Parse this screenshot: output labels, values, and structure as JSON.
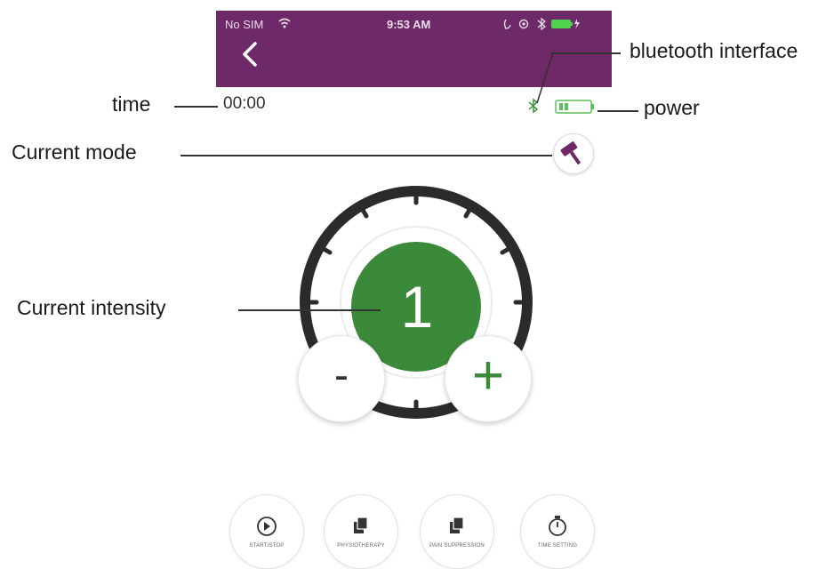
{
  "status_bar": {
    "carrier": "No SIM",
    "time": "9:53 AM",
    "background_color": "#6e2a68"
  },
  "header": {
    "back_icon": "chevron-left-icon",
    "timer": "00:00",
    "bluetooth_icon": "bluetooth-icon",
    "battery_icon": "battery-icon",
    "mode_icon": "hammer-icon"
  },
  "annotations": {
    "bluetooth": "bluetooth interface",
    "time": "time",
    "power": "power",
    "mode": "Current mode",
    "intensity": "Current intensity"
  },
  "control": {
    "intensity": "1",
    "decrease_label": "-",
    "increase_label": "+",
    "accent_color": "#3a8a3a"
  },
  "bottom_buttons": [
    {
      "label": "START/STOP",
      "icon": "play-icon"
    },
    {
      "label": "PHYSIOTHERAPY",
      "icon": "copy-icon"
    },
    {
      "label": "PAIN SUPPRESSION",
      "icon": "copy-icon"
    },
    {
      "label": "TIME SETTING",
      "icon": "stopwatch-icon"
    }
  ]
}
